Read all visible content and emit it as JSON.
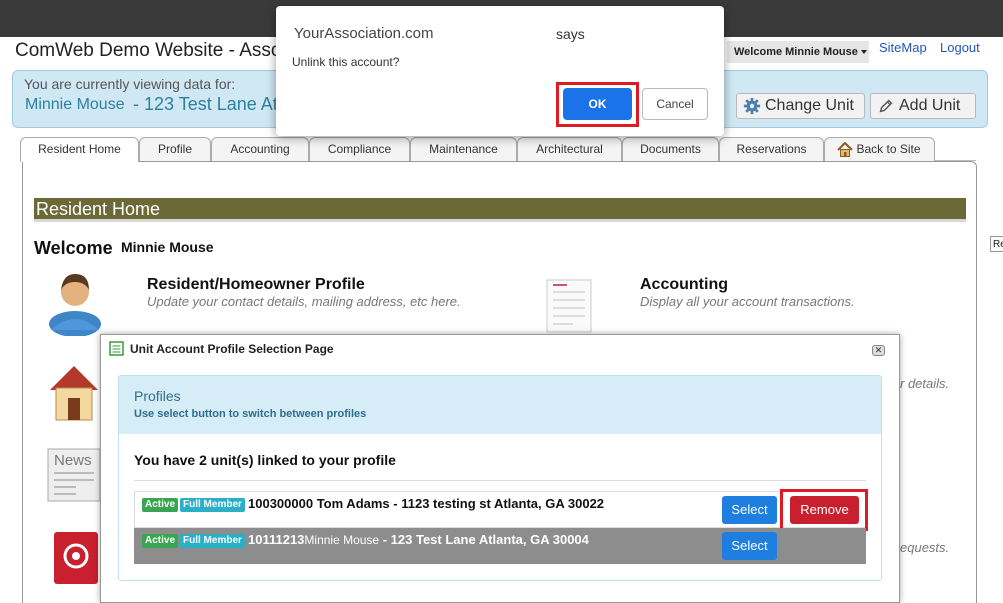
{
  "header": {
    "site_title": "ComWeb Demo Website - Asso",
    "welcome_user": "Welcome Minnie Mouse",
    "sitemap_link": "SiteMap",
    "logout_link": "Logout"
  },
  "viewing": {
    "label": "You are currently viewing data for:",
    "name": "Minnie Mouse",
    "address": "- 123 Test Lane At",
    "change_unit": "Change Unit",
    "add_unit": "Add Unit"
  },
  "tabs": [
    {
      "label": "Resident Home"
    },
    {
      "label": "Profile"
    },
    {
      "label": "Accounting"
    },
    {
      "label": "Compliance"
    },
    {
      "label": "Maintenance"
    },
    {
      "label": "Architectural"
    },
    {
      "label": "Documents"
    },
    {
      "label": "Reservations"
    },
    {
      "label": "Back to Site"
    }
  ],
  "content": {
    "section_title": "Resident Home",
    "welcome": "Welcome",
    "welcome_name": "Minnie Mouse",
    "profile_title": "Resident/Homeowner Profile",
    "profile_desc": "Update your contact details, mailing address, etc here.",
    "accounting_title": "Accounting",
    "accounting_desc": "Display all your account transactions.",
    "details_fragment": "r details.",
    "requests_fragment": "equests.",
    "news_icon_text": "News",
    "side_tip": "Re"
  },
  "modal": {
    "title": "Unit Account Profile Selection Page",
    "close_symbol": "✕",
    "profiles_title": "Profiles",
    "profiles_subtitle": "Use select button to switch between profiles",
    "linked_message": "You have 2 unit(s) linked to your profile",
    "rows": [
      {
        "status": "Active",
        "member": "Full Member",
        "account": "100300000",
        "name": "Tom Adams",
        "address": "- 1123 testing st Atlanta, GA 30022",
        "select": "Select",
        "remove": "Remove"
      },
      {
        "status": "Active",
        "member": "Full Member",
        "account": "10111213",
        "name": "Minnie Mouse",
        "address": "- 123 Test Lane Atlanta, GA 30004",
        "select": "Select"
      }
    ]
  },
  "alert": {
    "origin": "YourAssociation.com",
    "says": "says",
    "message": "Unlink this account?",
    "ok": "OK",
    "cancel": "Cancel"
  },
  "colors": {
    "accent_blue": "#1a73e8",
    "danger_red": "#c8202f",
    "highlight_outline": "#e01a24",
    "section_bar": "#6b6a37",
    "badge_active": "#3aa551",
    "badge_member": "#2bafc7"
  }
}
